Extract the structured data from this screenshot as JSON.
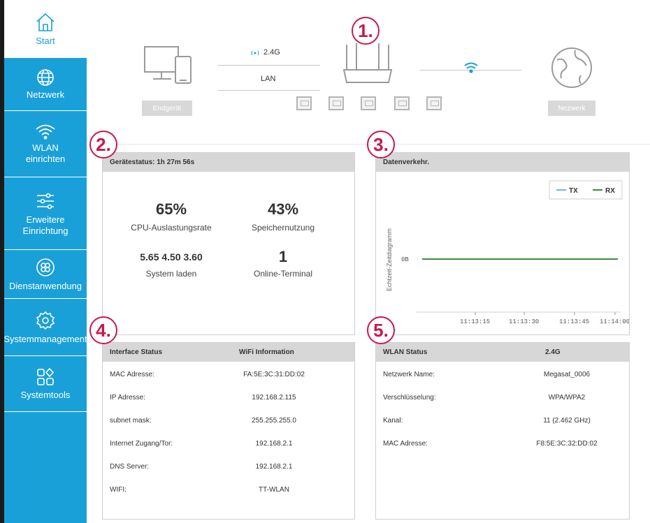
{
  "sidebar": {
    "items": [
      {
        "label": "Start",
        "icon": "home-icon",
        "active": true
      },
      {
        "label": "Netzwerk",
        "icon": "globe-icon"
      },
      {
        "label": "WLAN einrichten",
        "icon": "wifi-icon"
      },
      {
        "label": "Erweitere Einrichtung",
        "icon": "sliders-icon"
      },
      {
        "label": "Dienstanwendung",
        "icon": "flower-icon"
      },
      {
        "label": "Systemmanagement",
        "icon": "gear-icon"
      },
      {
        "label": "Systemtools",
        "icon": "apps-icon"
      }
    ]
  },
  "overview": {
    "device_label": "Endgerät",
    "band": "2.4G",
    "link": "LAN",
    "internet_label": "Nezwerk"
  },
  "callouts": [
    "1.",
    "2.",
    "3.",
    "4.",
    "5."
  ],
  "device_status": {
    "title": "Gerätestatus:  1h 27m 56s",
    "cpu_value": "65%",
    "cpu_label": "CPU-Auslastungsrate",
    "memory_value": "43%",
    "memory_label": "Speichernutzung",
    "load_value": "5.65 4.50 3.60",
    "load_label": "System laden",
    "terminals_value": "1",
    "terminals_label": "Online-Terminal"
  },
  "traffic": {
    "title": "Datenverkehr."
  },
  "chart_data": {
    "type": "line",
    "title": "",
    "xlabel": "",
    "ylabel": "Echtzeit-Zeitdiagramm",
    "x": [
      "11:13:15",
      "11:13:30",
      "11:13:45",
      "11:14:00"
    ],
    "yticks": [
      "0B"
    ],
    "series": [
      {
        "name": "TX",
        "color": "#6ab7e0",
        "values": [
          0,
          0,
          0,
          0
        ]
      },
      {
        "name": "RX",
        "color": "#3c8c3c",
        "values": [
          0,
          0,
          0,
          0
        ]
      }
    ],
    "legend": "top-right",
    "grid": false
  },
  "interface": {
    "head_left": "Interface Status",
    "head_right": "WiFi Information",
    "rows": [
      {
        "key": "MAC Adresse:",
        "value": "FA:5E:3C:31:DD:02"
      },
      {
        "key": "IP Adresse:",
        "value": "192.168.2.115"
      },
      {
        "key": "subnet mask:",
        "value": "255.255.255.0"
      },
      {
        "key": "Internet Zugang/Tor:",
        "value": "192.168.2.1"
      },
      {
        "key": "DNS Server:",
        "value": "192.168.2.1"
      },
      {
        "key": "WIFI:",
        "value": "TT-WLAN"
      }
    ]
  },
  "wlan": {
    "head_left": "WLAN Status",
    "head_right": "2.4G",
    "rows": [
      {
        "key": "Netzwerk Name:",
        "value": "Megasat_0006"
      },
      {
        "key": "Verschlüsselung:",
        "value": "WPA/WPA2"
      },
      {
        "key": "Kanal:",
        "value": "11 (2.462 GHz)"
      },
      {
        "key": "MAC Adresse:",
        "value": "F8:5E:3C:32:DD:02"
      }
    ]
  },
  "colors": {
    "accent": "#1aa0d8",
    "callout": "#c8184e",
    "header_bg": "#d7d7d7"
  }
}
